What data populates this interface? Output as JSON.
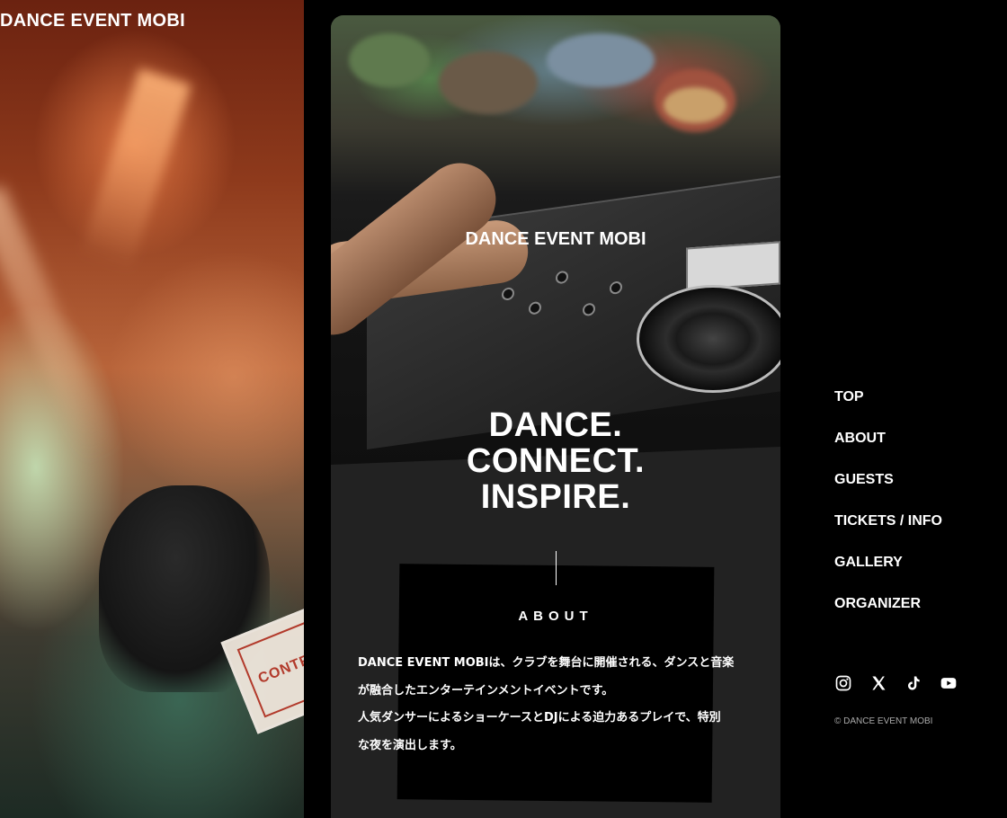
{
  "site": {
    "logo_text": "DANCE EVENT MOBI"
  },
  "hero": {
    "logo_text": "DANCE EVENT MOBI",
    "tagline_lines": [
      "DANCE.",
      "CONNECT.",
      "INSPIRE."
    ]
  },
  "left_photo": {
    "sign_text": "CONTR"
  },
  "about": {
    "heading": "ABOUT",
    "text_lines": [
      "DANCE EVENT MOBIは、クラブを舞台に開催される、ダンスと音楽",
      "が融合したエンターテインメントイベントです。",
      "人気ダンサーによるショーケースとDJによる迫力あるプレイで、特別",
      "な夜を演出します。"
    ]
  },
  "nav": {
    "items": [
      {
        "label": "TOP"
      },
      {
        "label": "ABOUT"
      },
      {
        "label": "GUESTS"
      },
      {
        "label": "TICKETS / INFO"
      },
      {
        "label": "GALLERY"
      },
      {
        "label": "ORGANIZER"
      }
    ]
  },
  "social": {
    "icons": [
      "instagram-icon",
      "x-icon",
      "tiktok-icon",
      "youtube-icon"
    ]
  },
  "footer": {
    "copyright": "© DANCE EVENT MOBI"
  },
  "colors": {
    "background": "#000000",
    "card": "#222222",
    "text": "#ffffff"
  }
}
